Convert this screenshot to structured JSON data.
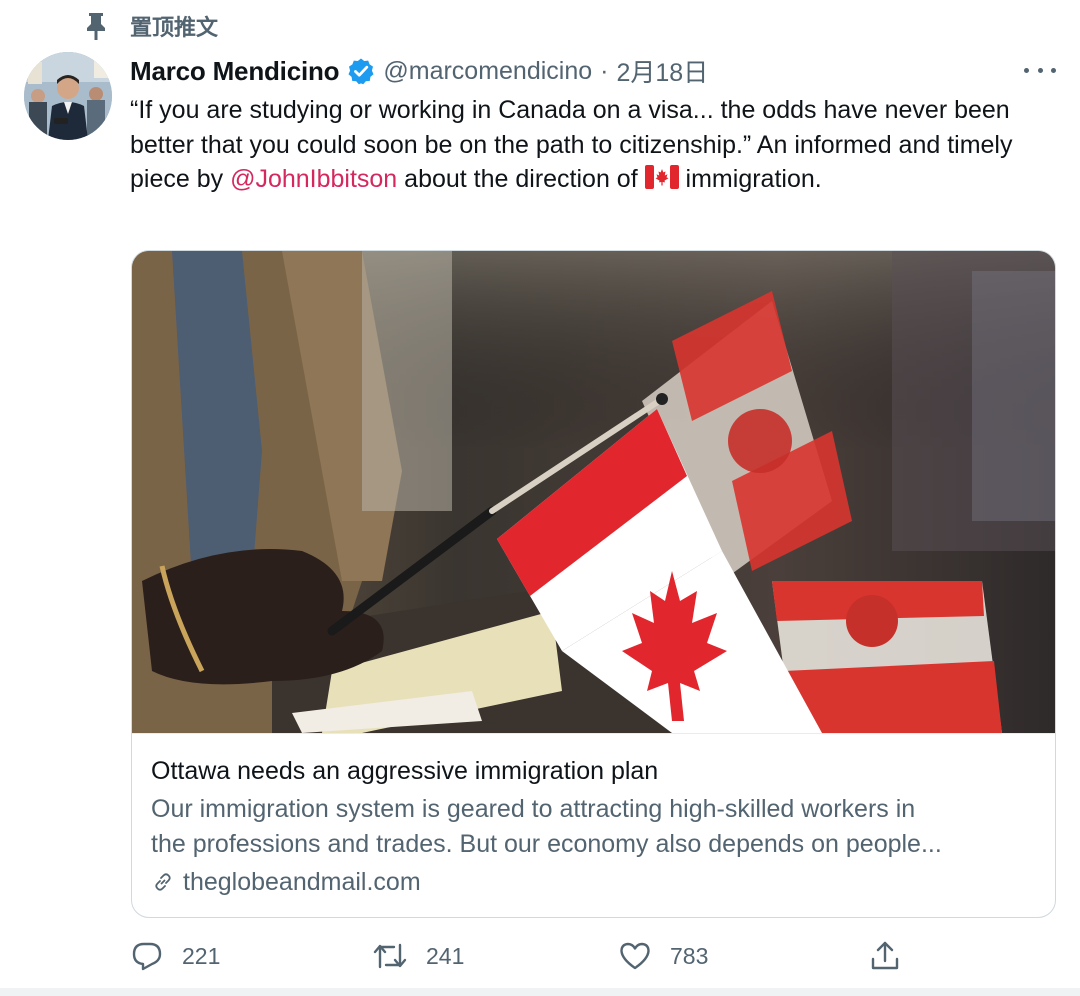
{
  "pinned": {
    "label": "置顶推文"
  },
  "author": {
    "display_name": "Marco Mendicino",
    "handle": "@marcomendicino",
    "separator": "·",
    "timestamp": "2月18日"
  },
  "tweet": {
    "text_before_mention": "“If you are studying or working in Canada on a visa... the odds have never been better that you could soon be on the path to citizenship.” An informed and timely piece by ",
    "mention": "@JohnIbbitson",
    "text_after_mention": " about the direction of ",
    "text_end": " immigration.",
    "flag_icon": "canada-flag-emoji"
  },
  "card": {
    "image_description_icon": "canada-flags-photo",
    "title": "Ottawa needs an aggressive immigration plan",
    "description_line1": "Our immigration system is geared to attracting high-skilled workers in",
    "description_line2": "the professions and trades. But our economy also depends on people...",
    "domain": "theglobeandmail.com"
  },
  "actions": {
    "reply_count": "221",
    "retweet_count": "241",
    "like_count": "783"
  },
  "colors": {
    "mention": "#d4285f",
    "verified": "#1d9bf0",
    "secondary_text": "#536471",
    "border": "#cfd9de"
  }
}
